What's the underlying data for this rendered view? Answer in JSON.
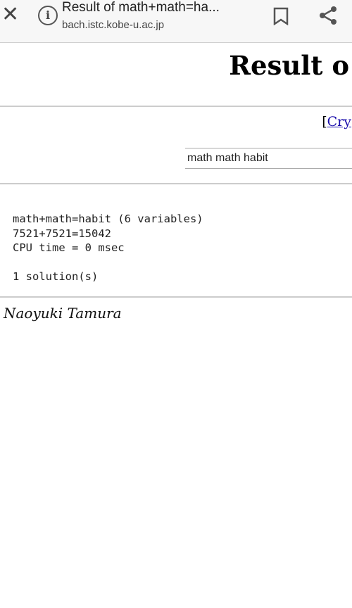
{
  "browser": {
    "title": "Result of math+math=ha...",
    "url": "bach.istc.kobe-u.ac.jp",
    "icons": [
      "close-icon",
      "info-icon",
      "bookmark-icon",
      "share-icon"
    ]
  },
  "page": {
    "heading": "Result o",
    "link_bracket": "[",
    "link_text": "Cry",
    "input_value": "math math habit",
    "result_lines": [
      "math+math=habit (6 variables)",
      "7521+7521=15042",
      "CPU time = 0 msec",
      "",
      "1 solution(s)"
    ],
    "author": "Naoyuki Tamura"
  }
}
